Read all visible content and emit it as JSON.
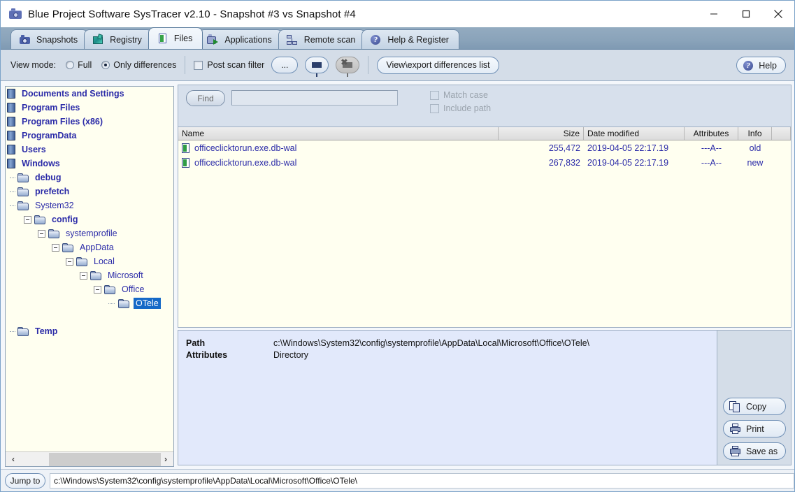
{
  "window": {
    "title": "Blue Project Software SysTracer v2.10 - Snapshot #3 vs Snapshot #4",
    "app_icon": "camera-icon",
    "minimize_label": "─",
    "maximize_label": "□",
    "close_label": "✕"
  },
  "tabs": [
    {
      "label": "Snapshots",
      "icon": "camera-icon",
      "active": false
    },
    {
      "label": "Registry",
      "icon": "registry-icon",
      "active": false
    },
    {
      "label": "Files",
      "icon": "file-icon",
      "active": true
    },
    {
      "label": "Applications",
      "icon": "application-icon",
      "active": false
    },
    {
      "label": "Remote scan",
      "icon": "network-icon",
      "active": false
    },
    {
      "label": "Help & Register",
      "icon": "help-icon",
      "active": false
    }
  ],
  "toolbar": {
    "view_mode_label": "View mode:",
    "radio_full": "Full",
    "radio_only_differences": "Only differences",
    "selected_view_mode": "Only differences",
    "post_scan_filter_label": "Post scan filter",
    "post_scan_filter_checked": false,
    "ellipsis_button": "...",
    "filter_button_icon": "funnel-icon",
    "clear_filter_button_icon": "funnel-clear-icon",
    "view_export_button": "View\\export differences list",
    "help_button": "Help",
    "help_icon": "help-icon"
  },
  "find": {
    "button_label": "Find",
    "input_value": "",
    "input_placeholder": "",
    "match_case_label": "Match case",
    "match_case_checked": false,
    "include_path_label": "Include path",
    "include_path_checked": false
  },
  "tree": {
    "nodes": [
      {
        "label": "Documents and Settings",
        "depth": 0,
        "icon": "drive-icon",
        "bold": true,
        "expander": "none",
        "selected": false
      },
      {
        "label": "Program Files",
        "depth": 0,
        "icon": "drive-icon",
        "bold": true,
        "expander": "none",
        "selected": false
      },
      {
        "label": "Program Files (x86)",
        "depth": 0,
        "icon": "drive-icon",
        "bold": true,
        "expander": "none",
        "selected": false
      },
      {
        "label": "ProgramData",
        "depth": 0,
        "icon": "drive-icon",
        "bold": true,
        "expander": "none",
        "selected": false
      },
      {
        "label": "Users",
        "depth": 0,
        "icon": "drive-icon",
        "bold": true,
        "expander": "none",
        "selected": false
      },
      {
        "label": "Windows",
        "depth": 0,
        "icon": "drive-icon",
        "bold": true,
        "expander": "none",
        "selected": false
      },
      {
        "label": "debug",
        "depth": 1,
        "icon": "folder-icon",
        "bold": true,
        "expander": "tick",
        "selected": false
      },
      {
        "label": "prefetch",
        "depth": 1,
        "icon": "folder-icon",
        "bold": true,
        "expander": "tick",
        "selected": false
      },
      {
        "label": "System32",
        "depth": 1,
        "icon": "folder-icon",
        "bold": false,
        "expander": "tick",
        "selected": false
      },
      {
        "label": "config",
        "depth": 2,
        "icon": "folder-icon",
        "bold": true,
        "expander": "minus",
        "selected": false
      },
      {
        "label": "systemprofile",
        "depth": 3,
        "icon": "folder-icon",
        "bold": false,
        "expander": "minus",
        "selected": false
      },
      {
        "label": "AppData",
        "depth": 4,
        "icon": "folder-icon",
        "bold": false,
        "expander": "minus",
        "selected": false
      },
      {
        "label": "Local",
        "depth": 5,
        "icon": "folder-icon",
        "bold": false,
        "expander": "minus",
        "selected": false
      },
      {
        "label": "Microsoft",
        "depth": 6,
        "icon": "folder-icon",
        "bold": false,
        "expander": "minus",
        "selected": false
      },
      {
        "label": "Office",
        "depth": 7,
        "icon": "folder-icon",
        "bold": false,
        "expander": "minus",
        "selected": false
      },
      {
        "label": "OTele",
        "depth": 8,
        "icon": "folder-icon",
        "bold": false,
        "expander": "stub",
        "selected": true
      },
      {
        "label": "",
        "depth": 0,
        "icon": "none",
        "bold": false,
        "expander": "none",
        "selected": false
      },
      {
        "label": "Temp",
        "depth": 1,
        "icon": "folder-icon",
        "bold": true,
        "expander": "tick",
        "selected": false
      }
    ],
    "hscroll": {
      "left_arrow": "‹",
      "right_arrow": "›"
    }
  },
  "file_list": {
    "columns": [
      "Name",
      "Size",
      "Date modified",
      "Attributes",
      "Info",
      ""
    ],
    "rows": [
      {
        "name": "officeclicktorun.exe.db-wal",
        "size": "255,472",
        "date_modified": "2019-04-05 22:17.19",
        "attributes": "---A--",
        "info": "old",
        "icon": "file-icon"
      },
      {
        "name": "officeclicktorun.exe.db-wal",
        "size": "267,832",
        "date_modified": "2019-04-05 22:17.19",
        "attributes": "---A--",
        "info": "new",
        "icon": "file-icon"
      }
    ]
  },
  "details": {
    "path_key": "Path",
    "path_value": "c:\\Windows\\System32\\config\\systemprofile\\AppData\\Local\\Microsoft\\Office\\OTele\\",
    "attributes_key": "Attributes",
    "attributes_value": "Directory"
  },
  "side_buttons": [
    {
      "label": "Copy",
      "icon": "copy-icon"
    },
    {
      "label": "Print",
      "icon": "printer-icon"
    },
    {
      "label": "Save as",
      "icon": "save-icon"
    }
  ],
  "status": {
    "jump_to_label": "Jump to",
    "path_value": "c:\\Windows\\System32\\config\\systemprofile\\AppData\\Local\\Microsoft\\Office\\OTele\\"
  },
  "colors": {
    "tree_text": "#2c2ca8",
    "selection": "#1569c7",
    "tabstrip": "#8aa3ba",
    "toolbar": "#d4dde8",
    "details_bg": "#e2e9fb",
    "tree_bg": "#fffff0"
  }
}
